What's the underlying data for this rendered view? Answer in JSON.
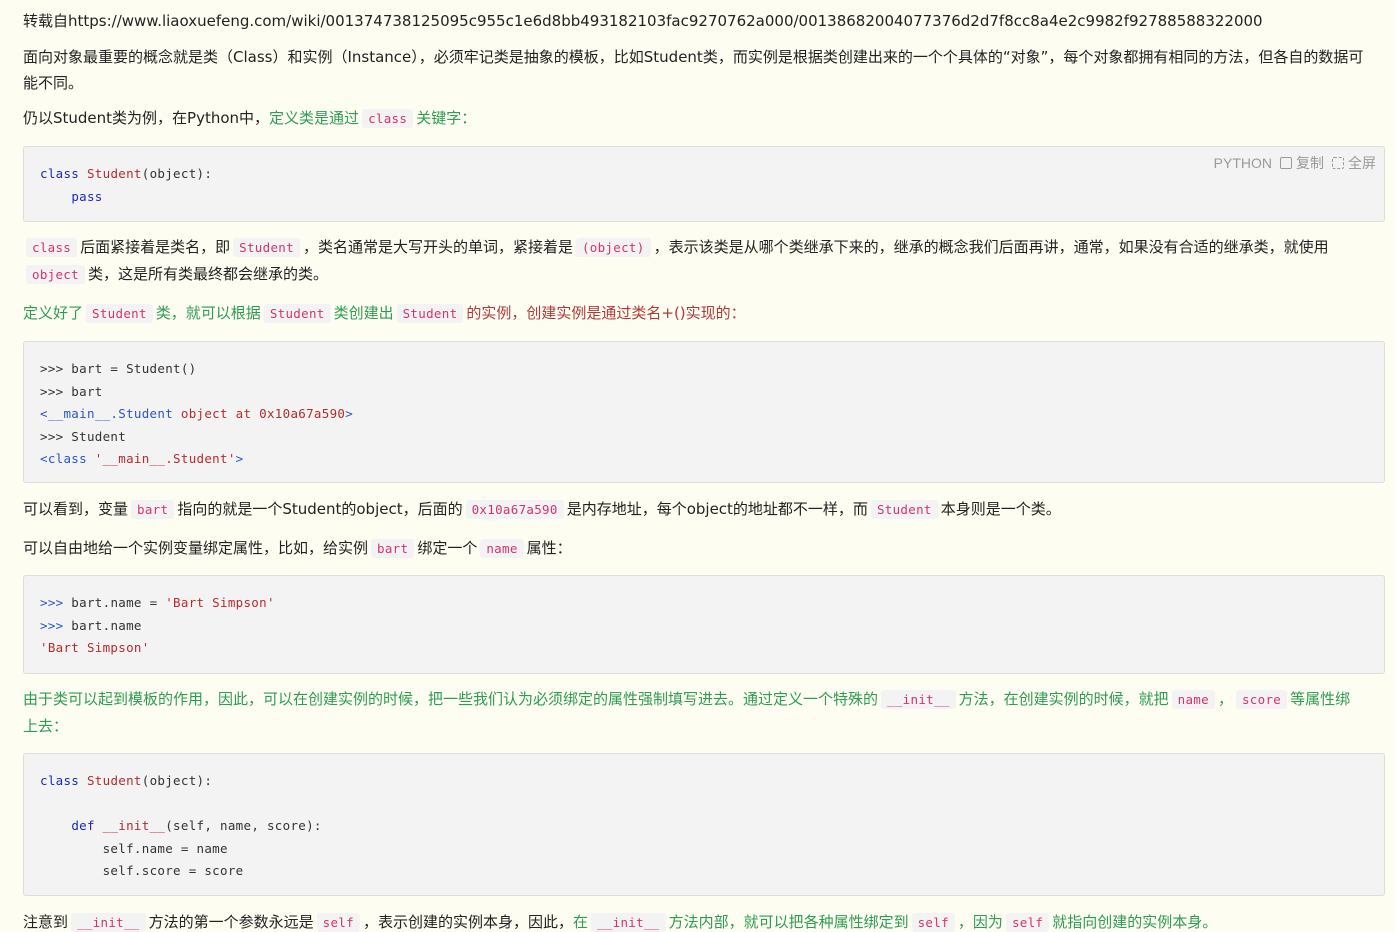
{
  "source_url": "转载自https://www.liaoxuefeng.com/wiki/001374738125095c955c1e6d8bb493182103fac9270762a000/00138682004077376d2d7f8cc8a4e2c9982f92788588322000",
  "p1": "面向对象最重要的概念就是类（Class）和实例（Instance），必须牢记类是抽象的模板，比如Student类，而实例是根据类创建出来的一个个具体的“对象”，每个对象都拥有相同的方法，但各自的数据可能不同。",
  "p2": {
    "a": "仍以Student类为例，在Python中，",
    "b": "定义类是通过",
    "code": "class",
    "c": "关键字："
  },
  "toolbar": {
    "lang": "PYTHON",
    "copy": "复制",
    "full": "全屏"
  },
  "code1": {
    "kw": "class",
    "cls": "Student",
    "rest": "(object):",
    "pass": "pass"
  },
  "p3": {
    "code1": "class",
    "t1": "后面紧接着是类名，即",
    "code2": "Student",
    "t2": "，类名通常是大写开头的单词，紧接着是",
    "code3": "(object)",
    "t3": "，表示该类是从哪个类继承下来的，继承的概念我们后面再讲，通常，如果没有合适的继承类，就使用",
    "code4": "object",
    "t4": "类，这是所有类最终都会继承的类。"
  },
  "p4": {
    "t1": "定义好了",
    "code1": "Student",
    "t2": "类，就可以根据",
    "code2": "Student",
    "t3": "类创建出",
    "code3": "Student",
    "t4": "的实例，创建实例是通过类名+()实现的："
  },
  "code2": {
    "l1": ">>> bart = Student()",
    "l2": ">>> bart",
    "l3a": "<__main__.Student ",
    "l3b": "object",
    "l3c": " at ",
    "l3d": "0x10a67a590",
    "l3e": ">",
    "l4": ">>> Student",
    "l5a": "<class ",
    "l5b": "'__main__.Student'",
    "l5c": ">"
  },
  "p5": {
    "t1": "可以看到，变量",
    "code1": "bart",
    "t2": "指向的就是一个Student的object，后面的",
    "code2": "0x10a67a590",
    "t3": "是内存地址，每个object的地址都不一样，而",
    "code3": "Student",
    "t4": "本身则是一个类。"
  },
  "p6": {
    "t1": "可以自由地给一个实例变量绑定属性，比如，给实例",
    "code1": "bart",
    "t2": "绑定一个",
    "code2": "name",
    "t3": "属性："
  },
  "code3": {
    "p": ">>>",
    "l1": " bart.name = ",
    "l1s": "'Bart Simpson'",
    "l2": " bart.name",
    "l3": "'Bart Simpson'"
  },
  "p7": {
    "t1": "由于类可以起到模板的作用，因此，可以在创建实例的时候，把一些我们认为必须绑定的属性强制填写进去。通过定义一个特殊的",
    "code1": "__init__",
    "t2": "方法，在创建实例的时候，就把",
    "code2": "name",
    "t3": "，",
    "code3": "score",
    "t4": "等属性绑上去："
  },
  "code4": {
    "kw": "class",
    "cls": "Student",
    "rest": "(object):",
    "def": "def",
    "init": "__init__",
    "args": "(self, name, score):",
    "l3": "self.name = name",
    "l4": "self.score = score"
  },
  "p8": {
    "t1": "注意到",
    "code1": "__init__",
    "t2": "方法的第一个参数永远是",
    "code2": "self",
    "t3": "，表示创建的实例本身，因此，",
    "t4": "在",
    "code3": "__init__",
    "t5": "方法内部，就可以把各种属性绑定到",
    "code4": "self",
    "t6": "，因为",
    "code5": "self",
    "t7": "就指向创建的实例本身。"
  }
}
